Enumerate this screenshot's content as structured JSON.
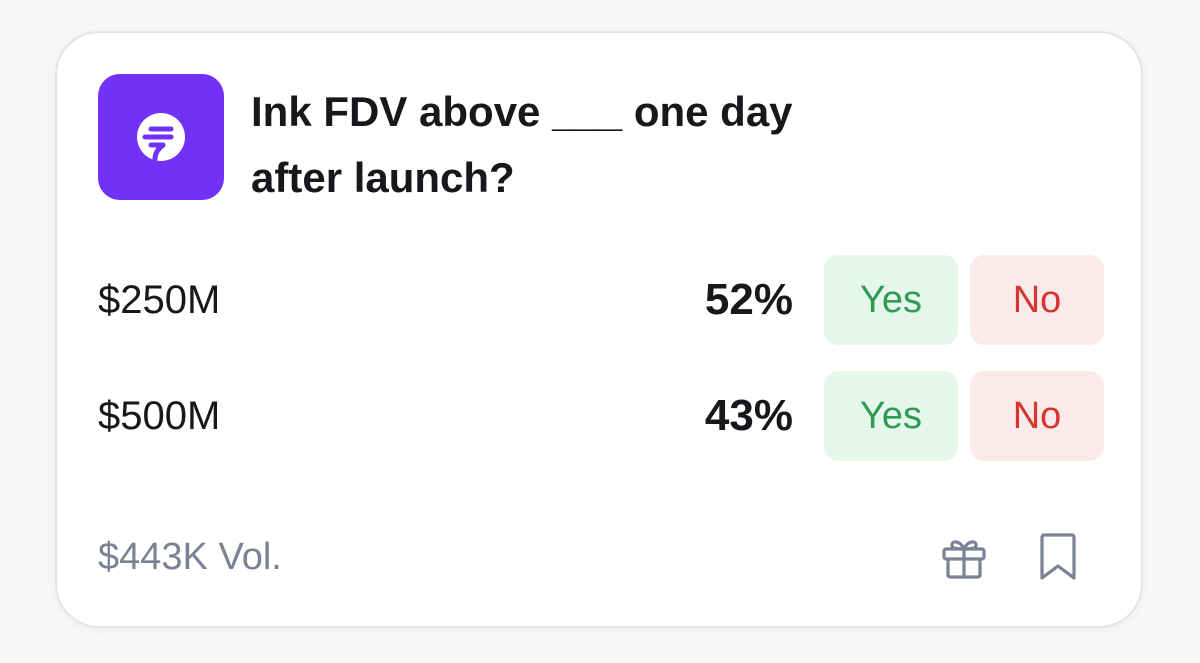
{
  "market": {
    "title": "Ink FDV above ___ one day after launch?",
    "logo_icon": "ink-logo-icon",
    "logo_color": "#7132f5"
  },
  "outcomes": [
    {
      "label": "$250M",
      "percent": "52%",
      "yes_label": "Yes",
      "no_label": "No"
    },
    {
      "label": "$500M",
      "percent": "43%",
      "yes_label": "Yes",
      "no_label": "No"
    }
  ],
  "footer": {
    "volume": "$443K Vol.",
    "gift_icon": "gift-icon",
    "bookmark_icon": "bookmark-icon"
  },
  "colors": {
    "yes_text": "#2f9a51",
    "yes_bg": "#e5f6ea",
    "no_text": "#d73530",
    "no_bg": "#fbeaea",
    "muted_text": "#7a8293"
  }
}
